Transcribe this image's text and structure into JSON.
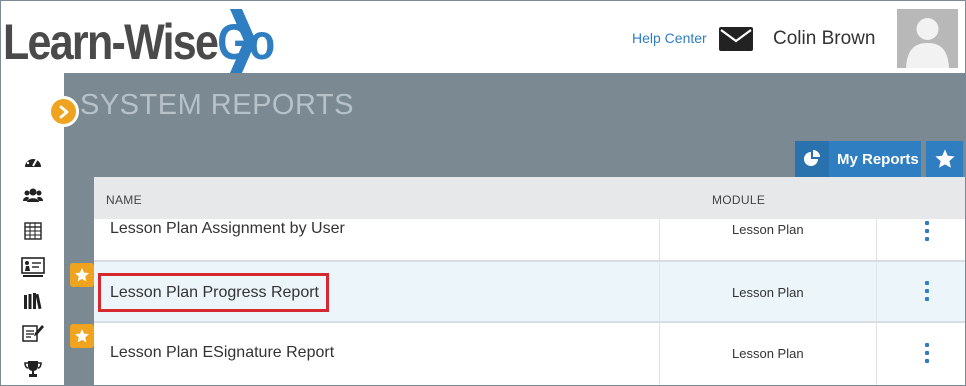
{
  "header": {
    "logo": {
      "text_main": "Learn-Wise",
      "text_go": "Go"
    },
    "help_link": "Help Center",
    "mail_icon": "envelope-icon",
    "user_name": "Colin Brown",
    "avatar_icon": "user-silhouette-icon"
  },
  "sidebar": {
    "items": [
      {
        "icon": "dashboard-gauge-icon"
      },
      {
        "icon": "users-group-icon"
      },
      {
        "icon": "grid-table-icon"
      },
      {
        "icon": "presentation-board-icon"
      },
      {
        "icon": "library-books-icon"
      },
      {
        "icon": "certificate-edit-icon"
      },
      {
        "icon": "trophy-icon"
      }
    ],
    "expand_icon": "chevron-right-icon"
  },
  "main": {
    "title": "SYSTEM REPORTS",
    "my_reports_label": "My Reports",
    "my_reports_icon": "pie-chart-icon",
    "favorites_icon": "star-icon"
  },
  "table": {
    "columns": [
      "NAME",
      "MODULE"
    ],
    "rows": [
      {
        "name": "Lesson Plan Assignment by User",
        "module": "Lesson Plan",
        "favorite": false,
        "selected": false
      },
      {
        "name": "Lesson Plan Progress Report",
        "module": "Lesson Plan",
        "favorite": true,
        "selected": true
      },
      {
        "name": "Lesson Plan ESignature Report",
        "module": "Lesson Plan",
        "favorite": true,
        "selected": false
      }
    ]
  },
  "colors": {
    "accent_blue": "#2f7ec1",
    "accent_orange": "#f0a31e",
    "header_gray": "#7b8993",
    "highlight_red": "#d6282f"
  }
}
